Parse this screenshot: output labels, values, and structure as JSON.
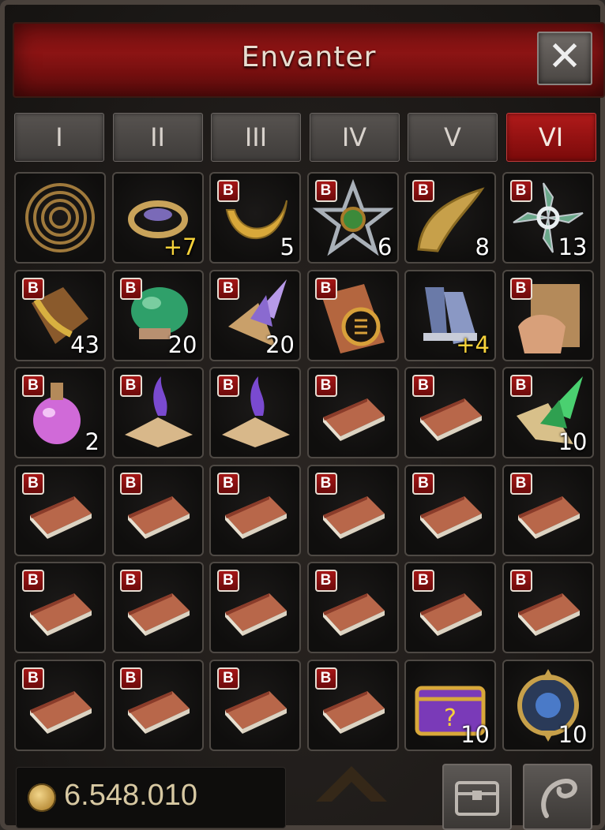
{
  "window": {
    "title": "Envanter",
    "close_symbol": "✕"
  },
  "tabs": [
    {
      "label": "I",
      "active": false
    },
    {
      "label": "II",
      "active": false
    },
    {
      "label": "III",
      "active": false
    },
    {
      "label": "IV",
      "active": false
    },
    {
      "label": "V",
      "active": false
    },
    {
      "label": "VI",
      "active": true
    }
  ],
  "bound_badge": "B",
  "slots": [
    {
      "icon": "spiral-ring-icon",
      "bound": false,
      "qty": ""
    },
    {
      "icon": "gem-bracelet-icon",
      "bound": false,
      "qty": "+7"
    },
    {
      "icon": "crescent-amulet-icon",
      "bound": true,
      "qty": "5"
    },
    {
      "icon": "pentagram-icon",
      "bound": true,
      "qty": "6"
    },
    {
      "icon": "golden-horn-icon",
      "bound": true,
      "qty": "8"
    },
    {
      "icon": "shuriken-icon",
      "bound": true,
      "qty": "13"
    },
    {
      "icon": "gold-scroll-icon",
      "bound": true,
      "qty": "43"
    },
    {
      "icon": "green-mushroom-icon",
      "bound": true,
      "qty": "20"
    },
    {
      "icon": "purple-crystal-icon",
      "bound": true,
      "qty": "20"
    },
    {
      "icon": "skill-book-icon",
      "bound": true,
      "qty": ""
    },
    {
      "icon": "boots-icon",
      "bound": false,
      "qty": "+4"
    },
    {
      "icon": "armor-scroll-icon",
      "bound": true,
      "qty": ""
    },
    {
      "icon": "potion-icon",
      "bound": true,
      "qty": "2"
    },
    {
      "icon": "purple-flame-book-icon",
      "bound": true,
      "qty": ""
    },
    {
      "icon": "purple-flame-book-icon",
      "bound": true,
      "qty": ""
    },
    {
      "icon": "book-icon",
      "bound": true,
      "qty": ""
    },
    {
      "icon": "book-icon",
      "bound": true,
      "qty": ""
    },
    {
      "icon": "green-crystal-icon",
      "bound": true,
      "qty": "10"
    },
    {
      "icon": "book-icon",
      "bound": true,
      "qty": ""
    },
    {
      "icon": "book-icon",
      "bound": true,
      "qty": ""
    },
    {
      "icon": "book-icon",
      "bound": true,
      "qty": ""
    },
    {
      "icon": "book-icon",
      "bound": true,
      "qty": ""
    },
    {
      "icon": "book-icon",
      "bound": true,
      "qty": ""
    },
    {
      "icon": "book-icon",
      "bound": true,
      "qty": ""
    },
    {
      "icon": "book-icon",
      "bound": true,
      "qty": ""
    },
    {
      "icon": "book-icon",
      "bound": true,
      "qty": ""
    },
    {
      "icon": "book-icon",
      "bound": true,
      "qty": ""
    },
    {
      "icon": "book-icon",
      "bound": true,
      "qty": ""
    },
    {
      "icon": "book-icon",
      "bound": true,
      "qty": ""
    },
    {
      "icon": "book-icon",
      "bound": true,
      "qty": ""
    },
    {
      "icon": "book-icon",
      "bound": true,
      "qty": ""
    },
    {
      "icon": "book-icon",
      "bound": true,
      "qty": ""
    },
    {
      "icon": "book-icon",
      "bound": true,
      "qty": ""
    },
    {
      "icon": "book-icon",
      "bound": true,
      "qty": ""
    },
    {
      "icon": "mystery-chest-icon",
      "bound": false,
      "qty": "10"
    },
    {
      "icon": "emblem-icon",
      "bound": false,
      "qty": "10"
    }
  ],
  "gold": {
    "amount": "6.548.010",
    "icon": "gold-coin-icon"
  },
  "footer_buttons": [
    {
      "icon": "chest-icon"
    },
    {
      "icon": "sort-icon"
    }
  ]
}
